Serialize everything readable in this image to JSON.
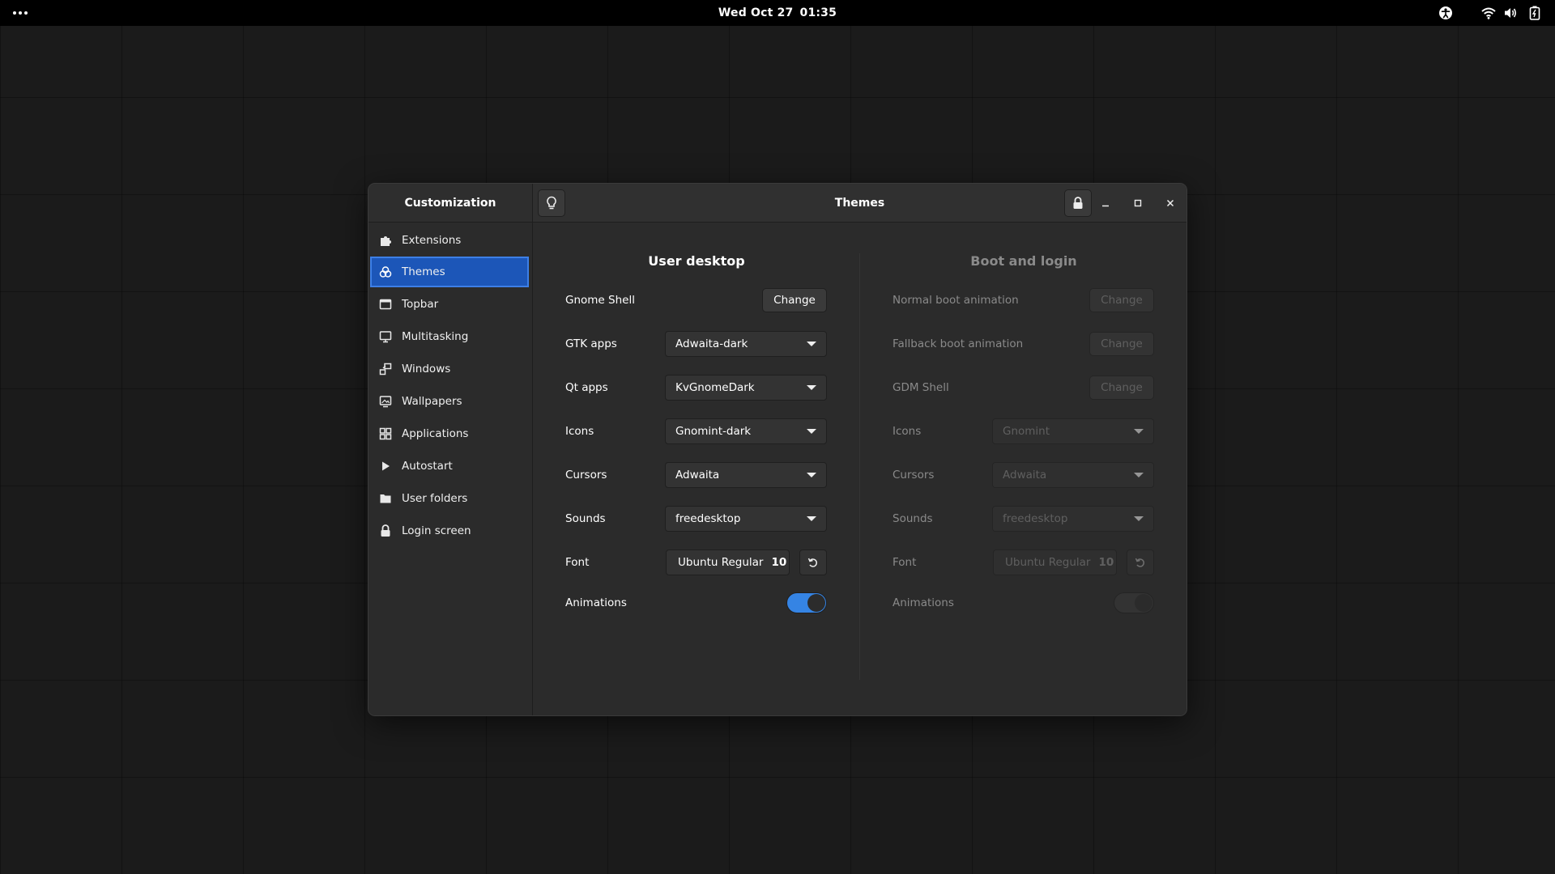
{
  "topbar": {
    "date": "Wed Oct 27",
    "time": "01:35",
    "icons": [
      "activities-dots-icon",
      "accessibility-icon",
      "wifi-icon",
      "volume-icon",
      "battery-icon"
    ]
  },
  "window": {
    "sidebar_title": "Customization",
    "main_title": "Themes",
    "header_icons": [
      "lightbulb-icon",
      "lock-icon",
      "minimize-icon",
      "maximize-icon",
      "close-icon"
    ]
  },
  "sidebar": {
    "items": [
      {
        "label": "Extensions",
        "icon": "puzzle-icon"
      },
      {
        "label": "Themes",
        "icon": "palette-icon",
        "selected": true
      },
      {
        "label": "Topbar",
        "icon": "topbar-icon"
      },
      {
        "label": "Multitasking",
        "icon": "monitor-icon"
      },
      {
        "label": "Windows",
        "icon": "windows-icon"
      },
      {
        "label": "Wallpapers",
        "icon": "wallpaper-icon"
      },
      {
        "label": "Applications",
        "icon": "grid-icon"
      },
      {
        "label": "Autostart",
        "icon": "play-icon"
      },
      {
        "label": "User folders",
        "icon": "folder-icon"
      },
      {
        "label": "Login screen",
        "icon": "lock-icon"
      }
    ]
  },
  "user_desktop": {
    "title": "User desktop",
    "gnome_shell": {
      "label": "Gnome Shell",
      "button": "Change"
    },
    "gtk_apps": {
      "label": "GTK apps",
      "value": "Adwaita-dark"
    },
    "qt_apps": {
      "label": "Qt apps",
      "value": "KvGnomeDark"
    },
    "icons": {
      "label": "Icons",
      "value": "Gnomint-dark"
    },
    "cursors": {
      "label": "Cursors",
      "value": "Adwaita"
    },
    "sounds": {
      "label": "Sounds",
      "value": "freedesktop"
    },
    "font": {
      "label": "Font",
      "name": "Ubuntu Regular",
      "size": "10"
    },
    "animations": {
      "label": "Animations",
      "on": true
    }
  },
  "boot_login": {
    "title": "Boot and login",
    "normal_boot": {
      "label": "Normal boot animation",
      "button": "Change"
    },
    "fallback_boot": {
      "label": "Fallback boot animation",
      "button": "Change"
    },
    "gdm_shell": {
      "label": "GDM Shell",
      "button": "Change"
    },
    "icons": {
      "label": "Icons",
      "value": "Gnomint"
    },
    "cursors": {
      "label": "Cursors",
      "value": "Adwaita"
    },
    "sounds": {
      "label": "Sounds",
      "value": "freedesktop"
    },
    "font": {
      "label": "Font",
      "name": "Ubuntu Regular",
      "size": "10"
    },
    "animations": {
      "label": "Animations",
      "on": false
    }
  },
  "colors": {
    "accent": "#1c56b8",
    "switch_on": "#3584e4",
    "window_bg": "#2b2b2b"
  }
}
